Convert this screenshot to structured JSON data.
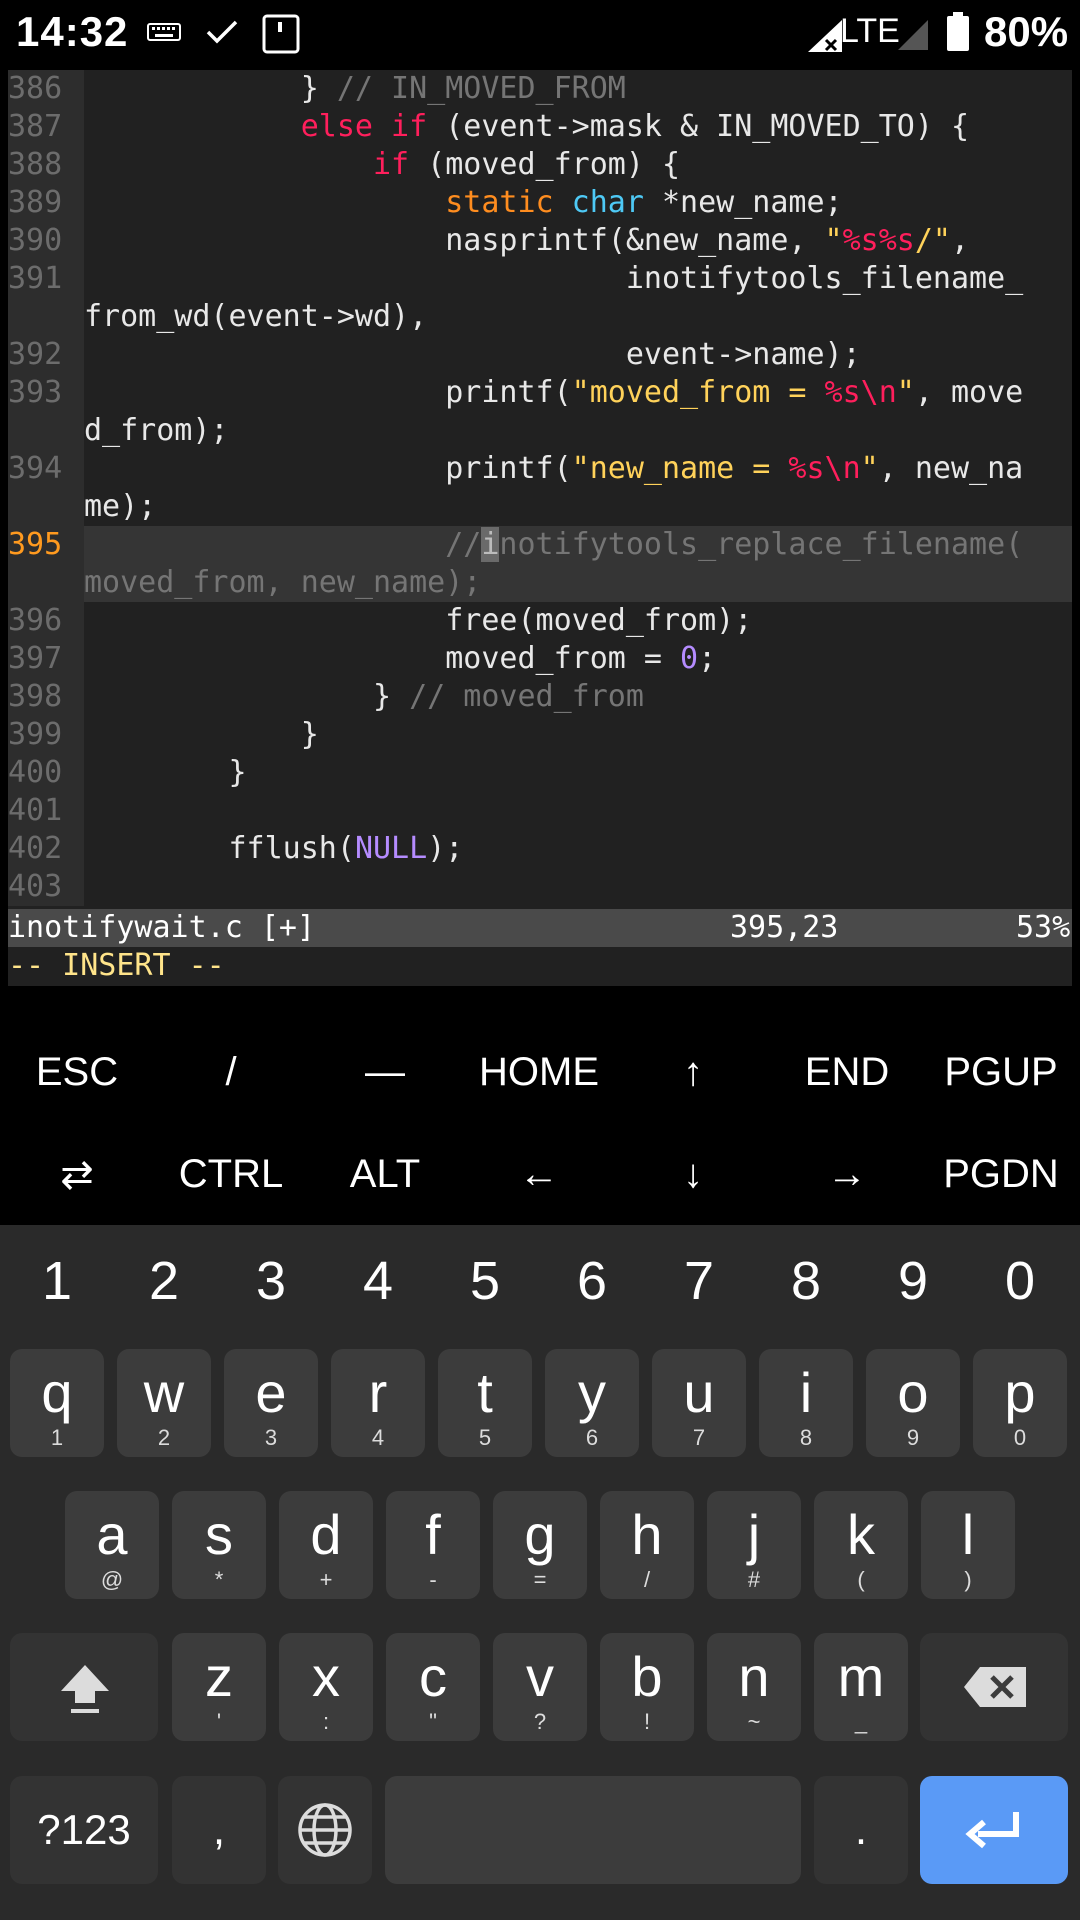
{
  "status_bar": {
    "time": "14:32",
    "network": "LTE",
    "battery": "80%"
  },
  "editor": {
    "lines": [
      {
        "n": "386",
        "segs": [
          [
            "",
            "            } "
          ],
          [
            "cmt",
            "// IN_MOVED_FROM"
          ]
        ]
      },
      {
        "n": "387",
        "segs": [
          [
            "",
            "            "
          ],
          [
            "kw",
            "else if"
          ],
          [
            "",
            " (event->mask & IN_MOVED_TO) {"
          ]
        ]
      },
      {
        "n": "388",
        "segs": [
          [
            "",
            "                "
          ],
          [
            "kw",
            "if"
          ],
          [
            "",
            " (moved_from) {"
          ]
        ]
      },
      {
        "n": "389",
        "segs": [
          [
            "",
            "                    "
          ],
          [
            "ty",
            "static"
          ],
          [
            "",
            " "
          ],
          [
            "ty2",
            "char"
          ],
          [
            "",
            " *new_name;"
          ]
        ]
      },
      {
        "n": "390",
        "segs": [
          [
            "",
            "                    nasprintf(&new_name, "
          ],
          [
            "str",
            "\""
          ],
          [
            "esc",
            "%s%s"
          ],
          [
            "str",
            "/\""
          ],
          [
            "",
            ","
          ]
        ]
      },
      {
        "n": "391",
        "segs": [
          [
            "",
            "                              inotifytools_filename_"
          ]
        ]
      },
      {
        "n": "",
        "segs": [
          [
            "",
            "from_wd(event->wd),"
          ]
        ]
      },
      {
        "n": "392",
        "segs": [
          [
            "",
            "                              event->name);"
          ]
        ]
      },
      {
        "n": "393",
        "segs": [
          [
            "",
            "                    printf("
          ],
          [
            "str",
            "\"moved_from = "
          ],
          [
            "esc",
            "%s\\n"
          ],
          [
            "str",
            "\""
          ],
          [
            "",
            ", move"
          ]
        ]
      },
      {
        "n": "",
        "segs": [
          [
            "",
            "d_from);"
          ]
        ]
      },
      {
        "n": "394",
        "segs": [
          [
            "",
            "                    printf("
          ],
          [
            "str",
            "\"new_name = "
          ],
          [
            "esc",
            "%s\\n"
          ],
          [
            "str",
            "\""
          ],
          [
            "",
            ", new_na"
          ]
        ]
      },
      {
        "n": "",
        "segs": [
          [
            "",
            "me);"
          ]
        ]
      },
      {
        "n": "395",
        "cur": true,
        "segs": [
          [
            "",
            "                    "
          ],
          [
            "cmt",
            "//"
          ],
          [
            "cursor",
            "i"
          ],
          [
            "cmt",
            "notifytools_replace_filename("
          ]
        ]
      },
      {
        "n": "",
        "cur": true,
        "segs": [
          [
            "cmt",
            "moved_from, new_name);"
          ]
        ]
      },
      {
        "n": "396",
        "segs": [
          [
            "",
            "                    free(moved_from);"
          ]
        ]
      },
      {
        "n": "397",
        "segs": [
          [
            "",
            "                    moved_from = "
          ],
          [
            "num",
            "0"
          ],
          [
            "",
            ";"
          ]
        ]
      },
      {
        "n": "398",
        "segs": [
          [
            "",
            "                } "
          ],
          [
            "cmt",
            "// moved_from"
          ]
        ]
      },
      {
        "n": "399",
        "segs": [
          [
            "",
            "            }"
          ]
        ]
      },
      {
        "n": "400",
        "segs": [
          [
            "",
            "        }"
          ]
        ]
      },
      {
        "n": "401",
        "segs": [
          [
            "",
            ""
          ]
        ]
      },
      {
        "n": "402",
        "segs": [
          [
            "",
            "        fflush("
          ],
          [
            "num",
            "NULL"
          ],
          [
            "",
            ");"
          ]
        ]
      },
      {
        "n": "403",
        "segs": [
          [
            "",
            ""
          ]
        ]
      }
    ],
    "filename": "inotifywait.c [+]",
    "position": "395,23",
    "percent": "53%",
    "mode": "-- INSERT --"
  },
  "extra_keys": {
    "row1": [
      "ESC",
      "/",
      "—",
      "HOME",
      "↑",
      "END",
      "PGUP"
    ],
    "row2": [
      "⇄",
      "CTRL",
      "ALT",
      "←",
      "↓",
      "→",
      "PGDN"
    ]
  },
  "keyboard": {
    "numbers": [
      "1",
      "2",
      "3",
      "4",
      "5",
      "6",
      "7",
      "8",
      "9",
      "0"
    ],
    "row1": [
      [
        "q",
        "1"
      ],
      [
        "w",
        "2"
      ],
      [
        "e",
        "3"
      ],
      [
        "r",
        "4"
      ],
      [
        "t",
        "5"
      ],
      [
        "y",
        "6"
      ],
      [
        "u",
        "7"
      ],
      [
        "i",
        "8"
      ],
      [
        "o",
        "9"
      ],
      [
        "p",
        "0"
      ]
    ],
    "row2": [
      [
        "a",
        "@"
      ],
      [
        "s",
        "*"
      ],
      [
        "d",
        "+"
      ],
      [
        "f",
        "-"
      ],
      [
        "g",
        "="
      ],
      [
        "h",
        "/"
      ],
      [
        "j",
        "#"
      ],
      [
        "k",
        "("
      ],
      [
        "l",
        ")"
      ]
    ],
    "row3": [
      [
        "z",
        "'"
      ],
      [
        "x",
        ":"
      ],
      [
        "c",
        "\""
      ],
      [
        "v",
        "?"
      ],
      [
        "b",
        "!"
      ],
      [
        "n",
        "~"
      ],
      [
        "m",
        "_"
      ]
    ],
    "symbols_label": "?123",
    "comma": ",",
    "period": ".",
    "icons": {
      "shift": "shift-icon",
      "backspace": "backspace-icon",
      "globe": "globe-icon",
      "enter": "enter-icon"
    },
    "colors": {
      "enter": "#5a9af6",
      "key": "#3c3c3c",
      "background": "#2a2a2a"
    }
  }
}
